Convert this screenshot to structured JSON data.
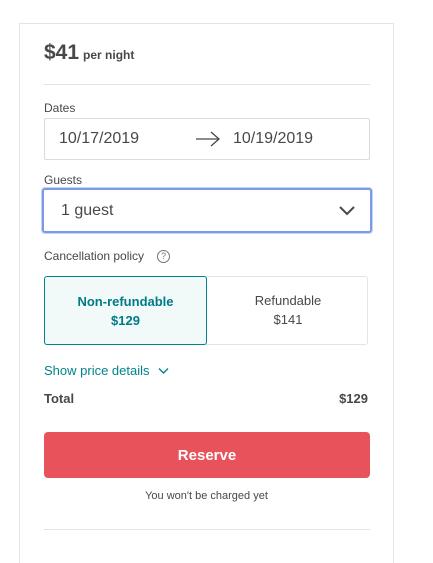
{
  "price": {
    "amount": "$41",
    "unit": "per night"
  },
  "dates": {
    "label": "Dates",
    "check_in": "10/17/2019",
    "check_out": "10/19/2019"
  },
  "guests": {
    "label": "Guests",
    "value": "1 guest"
  },
  "cancellation": {
    "label": "Cancellation policy",
    "help_icon": "question-circle-icon",
    "options": [
      {
        "name": "Non-refundable",
        "price": "$129",
        "selected": true
      },
      {
        "name": "Refundable",
        "price": "$141",
        "selected": false
      }
    ]
  },
  "price_details": {
    "label": "Show price details"
  },
  "total": {
    "label": "Total",
    "value": "$129"
  },
  "reserve": {
    "label": "Reserve",
    "note": "You won't be charged yet"
  },
  "colors": {
    "accent": "#008489",
    "reserve": "#e8525b",
    "focus_border": "#7c9ae6"
  }
}
